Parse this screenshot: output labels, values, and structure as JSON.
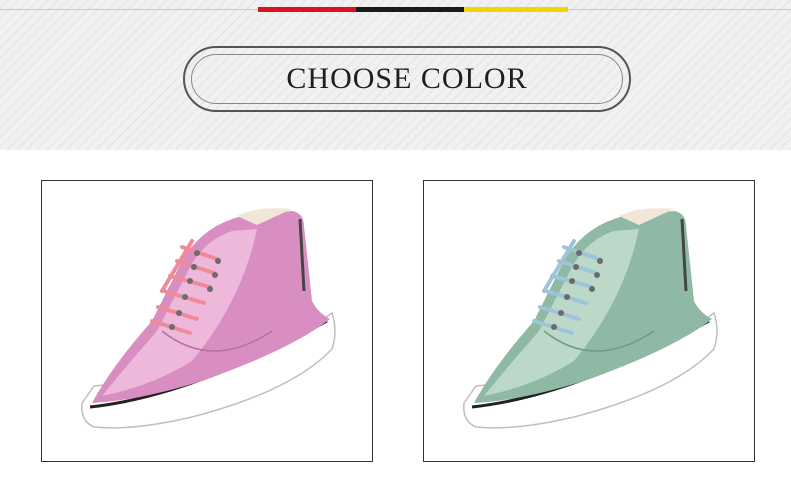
{
  "header": {
    "title": "CHOOSE COLOR",
    "flag_colors": [
      "#d9141c",
      "#1a1a1a",
      "#f2d500"
    ]
  },
  "products": [
    {
      "color_name": "pink",
      "upper": "#d98ec2",
      "upper_light": "#f3c5e2",
      "lace": "#f08a9a"
    },
    {
      "color_name": "green",
      "upper": "#8fb9a4",
      "upper_light": "#c9e3d6",
      "lace": "#9fc3d8"
    }
  ]
}
